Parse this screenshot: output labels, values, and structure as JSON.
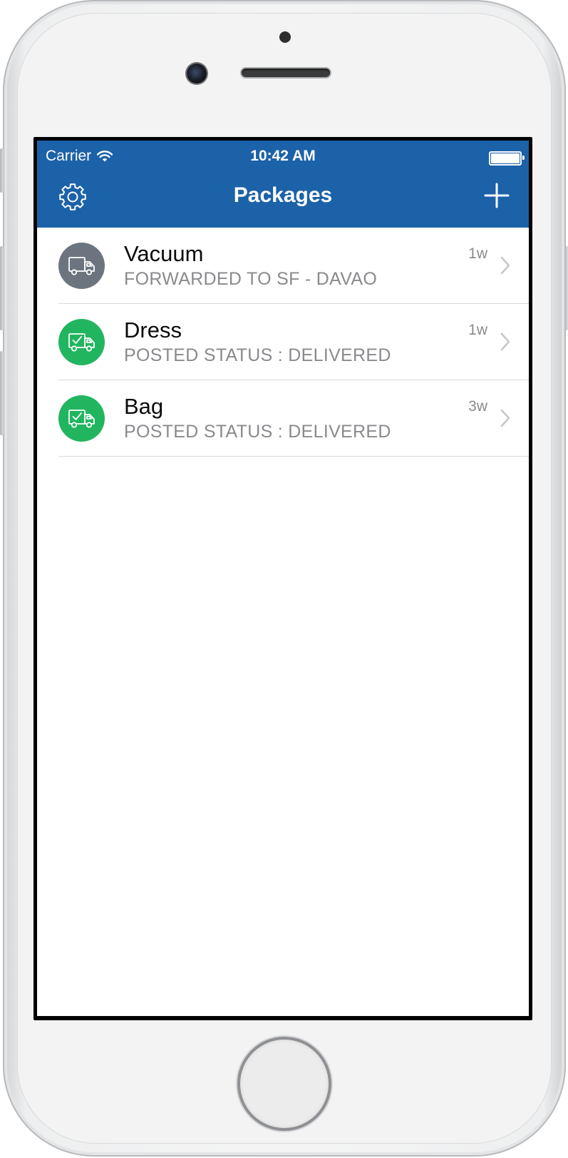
{
  "status_bar": {
    "carrier": "Carrier",
    "time": "10:42 AM"
  },
  "nav_bar": {
    "title": "Packages",
    "left_icon": "gear-icon",
    "right_icon": "plus-icon"
  },
  "colors": {
    "nav_background": "#1c62a8",
    "in_transit": "#6c757f",
    "delivered": "#22b55f",
    "subtitle": "#8a8a8e"
  },
  "packages": [
    {
      "name": "Vacuum",
      "status": "FORWARDED TO SF - DAVAO",
      "age": "1w",
      "icon": "truck-icon",
      "icon_color": "#6c757f"
    },
    {
      "name": "Dress",
      "status": "POSTED STATUS : DELIVERED",
      "age": "1w",
      "icon": "truck-check-icon",
      "icon_color": "#22b55f"
    },
    {
      "name": "Bag",
      "status": "POSTED STATUS : DELIVERED",
      "age": "3w",
      "icon": "truck-check-icon",
      "icon_color": "#22b55f"
    }
  ]
}
